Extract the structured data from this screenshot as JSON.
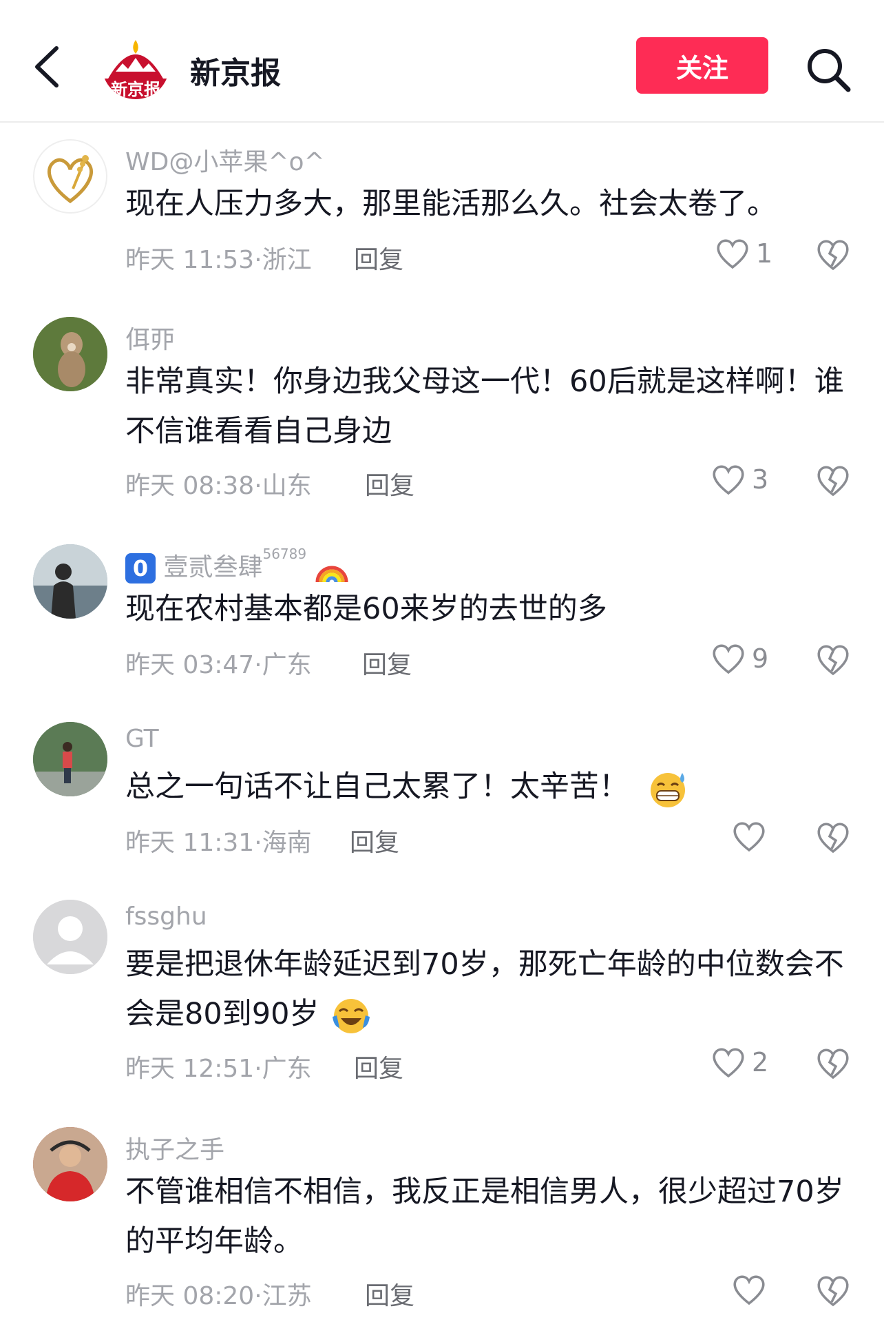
{
  "header": {
    "account_name": "新京报",
    "logo_text": "新京报",
    "follow_label": "关注"
  },
  "comments": [
    {
      "username": "WD@小苹果^o^",
      "text": "现在人压力多大，那里能活那么久。社会太卷了。",
      "time": "昨天 11:53",
      "region": "浙江",
      "reply": "回复",
      "likes": "1"
    },
    {
      "username": "佴丣",
      "text": "非常真实！你身边我父母这一代！60后就是这样啊！谁不信谁看看自己身边",
      "time": "昨天 08:38",
      "region": "山东",
      "reply": "回复",
      "likes": "3"
    },
    {
      "username_badge": "0",
      "username": "壹贰叁肆",
      "username_sup": "56789",
      "text": "现在农村基本都是60来岁的去世的多",
      "time": "昨天 03:47",
      "region": "广东",
      "reply": "回复",
      "likes": "9"
    },
    {
      "username": "GT",
      "text": "总之一句话不让自己太累了！太辛苦！",
      "time": "昨天 11:31",
      "region": "海南",
      "reply": "回复",
      "likes": ""
    },
    {
      "username": "fssghu",
      "text": "要是把退休年龄延迟到70岁，那死亡年龄的中位数会不会是80到90岁",
      "time": "昨天 12:51",
      "region": "广东",
      "reply": "回复",
      "likes": "2"
    },
    {
      "username": "执子之手",
      "text": "不管谁相信不相信，我反正是相信男人，很少超过70岁的平均年龄。",
      "time": "昨天 08:20",
      "region": "江苏",
      "reply": "回复",
      "likes": ""
    }
  ],
  "colors": {
    "accent": "#fe2c55",
    "muted": "#a3a5ab"
  },
  "icons": [
    "back-arrow-icon",
    "search-icon",
    "heart-icon",
    "broken-heart-icon",
    "rainbow-emoji",
    "sweat-grin-emoji",
    "laugh-cry-emoji"
  ]
}
